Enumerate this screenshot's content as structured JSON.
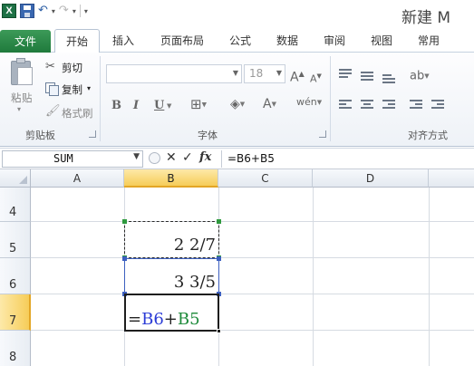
{
  "title_bar": {
    "title": "新建 M",
    "app_icon": "excel-icon",
    "quick_access": [
      "save-icon",
      "undo-icon",
      "redo-icon",
      "customize-icon"
    ]
  },
  "tabs": [
    {
      "label": "文件"
    },
    {
      "label": "开始"
    },
    {
      "label": "插入"
    },
    {
      "label": "页面布局"
    },
    {
      "label": "公式"
    },
    {
      "label": "数据"
    },
    {
      "label": "审阅"
    },
    {
      "label": "视图"
    },
    {
      "label": "常用"
    }
  ],
  "clipboard": {
    "paste_label_1": "粘",
    "paste_label_2": "贴",
    "cut_label": "剪切",
    "copy_label": "复制",
    "format_painter_label": "格式刷",
    "group_label": "剪贴板"
  },
  "font": {
    "font_name": "",
    "font_size": "18",
    "bold": "B",
    "italic": "I",
    "underline": "U",
    "group_label": "字体"
  },
  "alignment": {
    "group_label": "对齐方式"
  },
  "formula_bar": {
    "name_box": "SUM",
    "formula": "=B6+B5",
    "fx_label": "fx"
  },
  "grid": {
    "columns": [
      "A",
      "B",
      "C",
      "D"
    ],
    "rows": [
      "4",
      "5",
      "6",
      "7",
      "8"
    ],
    "selected_column": "B",
    "selected_row": "7",
    "cells": {
      "B5": "2 2/7",
      "B6": "3 3/5"
    },
    "edit_formula": {
      "eq": "=",
      "ref1": "B6",
      "op": "+",
      "ref2": "B5"
    }
  },
  "colors": {
    "ref1_color": "#2a3bd6",
    "ref2_color": "#1d8a3a",
    "file_tab": "#2b8a4a",
    "selection_header": "#f6cd59"
  }
}
